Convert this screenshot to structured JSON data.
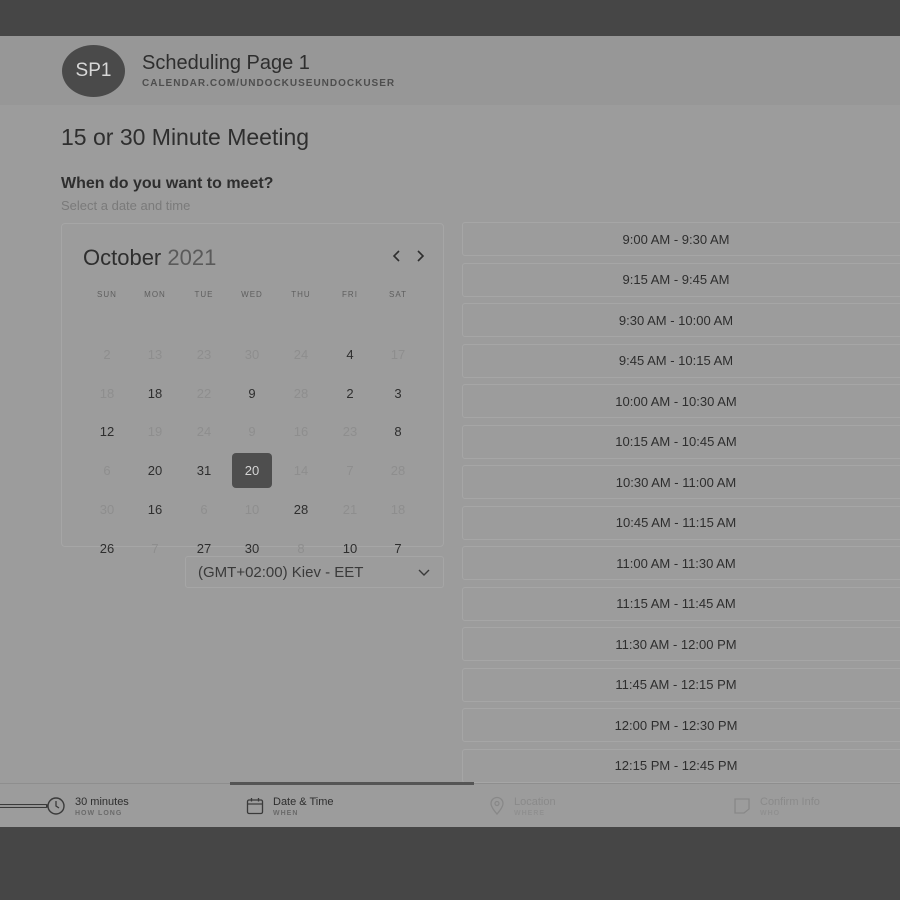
{
  "header": {
    "avatar_initials": "SP1",
    "page_name": "Scheduling Page 1",
    "page_url": "CALENDAR.COM/UNDOCKUSEUNDOCKUSER"
  },
  "meeting": {
    "title": "15 or 30 Minute Meeting",
    "question": "When do you want to meet?",
    "hint": "Select a date and time"
  },
  "calendar": {
    "month": "October",
    "year": "2021",
    "weekdays": [
      "SUN",
      "MON",
      "TUE",
      "WED",
      "THU",
      "FRI",
      "SAT"
    ],
    "rows": [
      [
        {
          "d": "2",
          "a": false
        },
        {
          "d": "13",
          "a": false
        },
        {
          "d": "23",
          "a": false
        },
        {
          "d": "30",
          "a": false
        },
        {
          "d": "24",
          "a": false
        },
        {
          "d": "4",
          "a": true
        },
        {
          "d": "17",
          "a": false
        }
      ],
      [
        {
          "d": "18",
          "a": false
        },
        {
          "d": "18",
          "a": true
        },
        {
          "d": "22",
          "a": false
        },
        {
          "d": "9",
          "a": true
        },
        {
          "d": "28",
          "a": false
        },
        {
          "d": "2",
          "a": true
        },
        {
          "d": "3",
          "a": true
        }
      ],
      [
        {
          "d": "12",
          "a": true
        },
        {
          "d": "19",
          "a": false
        },
        {
          "d": "24",
          "a": false
        },
        {
          "d": "9",
          "a": false
        },
        {
          "d": "16",
          "a": false
        },
        {
          "d": "23",
          "a": false
        },
        {
          "d": "8",
          "a": true
        }
      ],
      [
        {
          "d": "6",
          "a": false
        },
        {
          "d": "20",
          "a": true
        },
        {
          "d": "31",
          "a": true
        },
        {
          "d": "20",
          "a": true,
          "selected": true
        },
        {
          "d": "14",
          "a": false
        },
        {
          "d": "7",
          "a": false
        },
        {
          "d": "28",
          "a": false
        }
      ],
      [
        {
          "d": "30",
          "a": false
        },
        {
          "d": "16",
          "a": true
        },
        {
          "d": "6",
          "a": false
        },
        {
          "d": "10",
          "a": false
        },
        {
          "d": "28",
          "a": true
        },
        {
          "d": "21",
          "a": false
        },
        {
          "d": "18",
          "a": false
        }
      ],
      [
        {
          "d": "26",
          "a": true
        },
        {
          "d": "7",
          "a": false
        },
        {
          "d": "27",
          "a": true
        },
        {
          "d": "30",
          "a": true
        },
        {
          "d": "8",
          "a": false
        },
        {
          "d": "10",
          "a": true
        },
        {
          "d": "7",
          "a": true
        }
      ]
    ]
  },
  "timezone": {
    "selected": "(GMT+02:00) Kiev - EET"
  },
  "time_slots": [
    "9:00 AM - 9:30 AM",
    "9:15 AM - 9:45 AM",
    "9:30 AM - 10:00 AM",
    "9:45 AM - 10:15 AM",
    "10:00 AM - 10:30 AM",
    "10:15 AM - 10:45 AM",
    "10:30 AM - 11:00 AM",
    "10:45 AM - 11:15 AM",
    "11:00 AM - 11:30 AM",
    "11:15 AM - 11:45 AM",
    "11:30 AM - 12:00 PM",
    "11:45 AM - 12:15 PM",
    "12:00 PM - 12:30 PM",
    "12:15 PM - 12:45 PM"
  ],
  "steps": [
    {
      "title": "30 minutes",
      "sub": "HOW LONG",
      "icon": "clock-icon"
    },
    {
      "title": "Date & Time",
      "sub": "WHEN",
      "icon": "calendar-icon",
      "active": true
    },
    {
      "title": "Location",
      "sub": "WHERE",
      "icon": "location-pin-icon"
    },
    {
      "title": "Confirm Info",
      "sub": "WHO",
      "icon": "form-icon"
    }
  ]
}
